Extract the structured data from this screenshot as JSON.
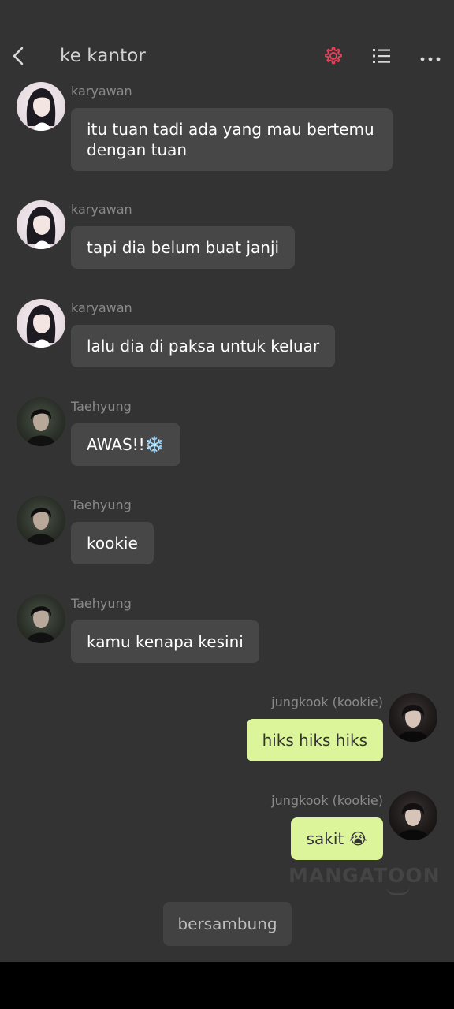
{
  "header": {
    "title": "ke kantor",
    "back_icon": "chevron-left-icon",
    "settings_icon": "gear-icon",
    "list_icon": "list-icon",
    "more_icon": "more-horizontal-icon",
    "accent_color": "#e8415a"
  },
  "messages": [
    {
      "sender": "karyawan",
      "side": "left",
      "avatar": "woman",
      "text": "itu tuan tadi ada yang mau bertemu dengan tuan"
    },
    {
      "sender": "karyawan",
      "side": "left",
      "avatar": "woman",
      "text": "tapi dia belum buat janji"
    },
    {
      "sender": "karyawan",
      "side": "left",
      "avatar": "woman",
      "text": "lalu dia di paksa untuk keluar"
    },
    {
      "sender": "Taehyung",
      "side": "left",
      "avatar": "taehyung",
      "text": "AWAS!!❄️"
    },
    {
      "sender": "Taehyung",
      "side": "left",
      "avatar": "taehyung",
      "text": "kookie"
    },
    {
      "sender": "Taehyung",
      "side": "left",
      "avatar": "taehyung",
      "text": "kamu kenapa kesini"
    },
    {
      "sender": "jungkook (kookie)",
      "side": "right",
      "avatar": "jungkook",
      "text": "hiks hiks hiks"
    },
    {
      "sender": "jungkook (kookie)",
      "side": "right",
      "avatar": "jungkook",
      "text": "sakit 😭"
    }
  ],
  "watermark": "MANGATOON",
  "footer": {
    "to_be_continued": "bersambung"
  },
  "colors": {
    "background": "#333333",
    "bubble_left": "#474747",
    "bubble_right": "#dcf59a",
    "sender_text": "#8a8a8a"
  }
}
